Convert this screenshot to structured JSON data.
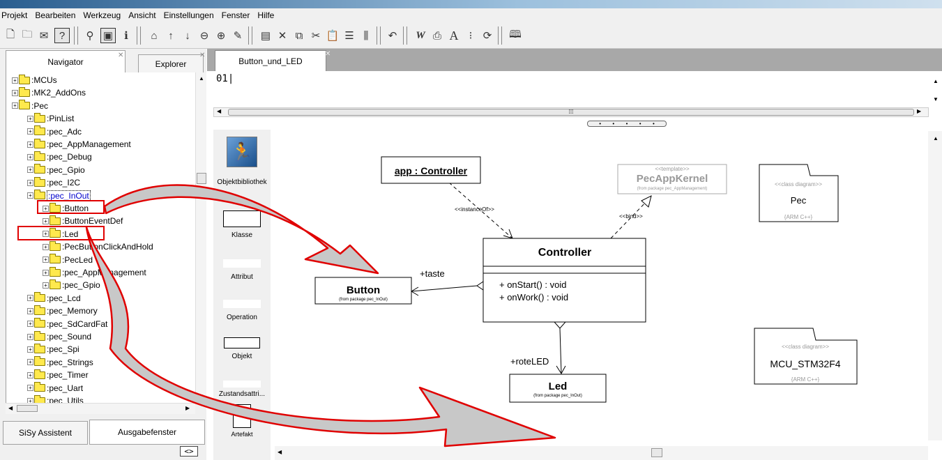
{
  "menu": [
    "Projekt",
    "Bearbeiten",
    "Werkzeug",
    "Ansicht",
    "Einstellungen",
    "Fenster",
    "Hilfe"
  ],
  "toolbar_icons": [
    "new-icon",
    "open-icon",
    "mail-icon",
    "help-icon",
    "find-icon",
    "window-icon",
    "info-icon",
    "home-icon",
    "up-icon",
    "down-icon",
    "zoom-out-icon",
    "zoom-in-icon",
    "edit-icon",
    "properties-icon",
    "delete-icon",
    "copy-icon",
    "cut-icon",
    "paste-icon",
    "list-icon",
    "columns-icon",
    "undo-icon",
    "word-icon",
    "print-icon",
    "font-icon",
    "bullets-icon",
    "refresh-icon",
    "book-icon"
  ],
  "left_tabs": {
    "navigator": "Navigator",
    "explorer": "Explorer"
  },
  "tree": [
    {
      "label": ":MCUs",
      "level": 0
    },
    {
      "label": ":MK2_AddOns",
      "level": 0
    },
    {
      "label": ":Pec",
      "level": 0
    },
    {
      "label": ":PinList",
      "level": 1
    },
    {
      "label": ":pec_Adc",
      "level": 1
    },
    {
      "label": ":pec_AppManagement",
      "level": 1
    },
    {
      "label": ":pec_Debug",
      "level": 1
    },
    {
      "label": ":pec_Gpio",
      "level": 1
    },
    {
      "label": ":pec_I2C",
      "level": 1
    },
    {
      "label": ":pec_InOut",
      "level": 1,
      "selected": true
    },
    {
      "label": ":Button",
      "level": 2,
      "highlight": true
    },
    {
      "label": ":ButtonEventDef",
      "level": 2
    },
    {
      "label": ":Led",
      "level": 2,
      "highlight": true
    },
    {
      "label": ":PecButtonClickAndHold",
      "level": 2
    },
    {
      "label": ":PecLed",
      "level": 2
    },
    {
      "label": ":pec_AppManagement",
      "level": 2
    },
    {
      "label": ":pec_Gpio",
      "level": 2
    },
    {
      "label": ":pec_Lcd",
      "level": 1
    },
    {
      "label": ":pec_Memory",
      "level": 1
    },
    {
      "label": ":pec_SdCardFat",
      "level": 1
    },
    {
      "label": ":pec_Sound",
      "level": 1
    },
    {
      "label": ":pec_Spi",
      "level": 1
    },
    {
      "label": ":pec_Strings",
      "level": 1
    },
    {
      "label": ":pec_Timer",
      "level": 1
    },
    {
      "label": ":pec_Uart",
      "level": 1
    },
    {
      "label": ":pec_Utils",
      "level": 1
    }
  ],
  "bottom_tabs": {
    "assistant": "SiSy Assistent",
    "output": "Ausgabefenster"
  },
  "bottom_btn": "<>",
  "doc_tab": "Button_und_LED",
  "code_text": "01|",
  "palette": [
    "Objektbibliothek",
    "Klasse",
    "Attribut",
    "Operation",
    "Objekt",
    "Zustandsattri...",
    "Artefakt"
  ],
  "diagram": {
    "app_obj": "app : Controller",
    "instance_of": "<<instanceOf>>",
    "template_stereo": "<<template>>",
    "template_name": "PecAppKernel",
    "template_pkg": "(from package pec_AppManagement)",
    "bind": "<<bind>>",
    "controller": "Controller",
    "op1": "+ onStart() : void",
    "op2": "+ onWork() : void",
    "taste": "+taste",
    "button": "Button",
    "button_pkg": "(from package pec_InOut)",
    "rote": "+roteLED",
    "led": "Led",
    "led_pkg": "(from package pec_InOut)",
    "pec_stereo": "<<class diagram>>",
    "pec_name": "Pec",
    "pec_lang": "{ARM C++}",
    "mcu_stereo": "<<class diagram>>",
    "mcu_name": "MCU_STM32F4",
    "mcu_lang": "{ARM C++}"
  }
}
